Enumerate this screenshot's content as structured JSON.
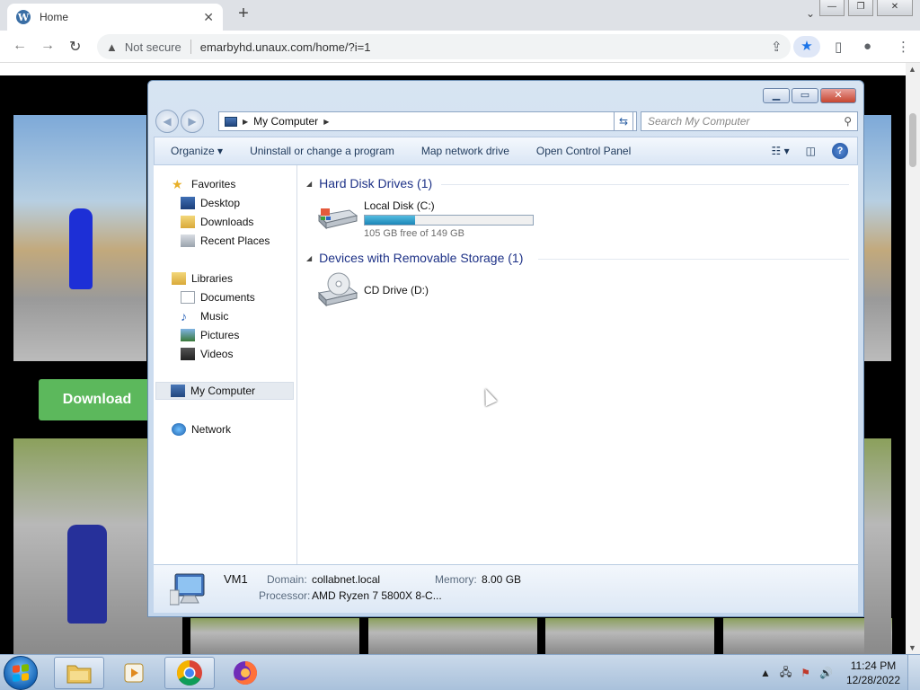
{
  "browser": {
    "tab_title": "Home",
    "tab_close": "✕",
    "new_tab": "+",
    "not_secure": "Not secure",
    "url": "emarbyhd.unaux.com/home/?i=1"
  },
  "page": {
    "download_label": "Download"
  },
  "explorer": {
    "breadcrumb": "My Computer",
    "search_placeholder": "Search My Computer",
    "commands": [
      "Organize ▾",
      "Uninstall or change a program",
      "Map network drive",
      "Open Control Panel"
    ],
    "nav": {
      "favorites": "Favorites",
      "desktop": "Desktop",
      "downloads": "Downloads",
      "recent_places": "Recent Places",
      "libraries": "Libraries",
      "documents": "Documents",
      "music": "Music",
      "pictures": "Pictures",
      "videos": "Videos",
      "my_computer": "My Computer",
      "network": "Network"
    },
    "groups": {
      "hdd": "Hard Disk Drives (1)",
      "removable": "Devices with Removable Storage (1)"
    },
    "drives": {
      "c_name": "Local Disk (C:)",
      "c_free": "105 GB free of 149 GB",
      "c_used_fraction": 0.3,
      "d_name": "CD Drive (D:)"
    },
    "details": {
      "computer_name": "VM1",
      "domain_label": "Domain:",
      "domain_value": "collabnet.local",
      "memory_label": "Memory:",
      "memory_value": "8.00 GB",
      "processor_label": "Processor:",
      "processor_value": "AMD Ryzen 7 5800X 8-C..."
    }
  },
  "taskbar": {
    "time": "11:24 PM",
    "date": "12/28/2022"
  },
  "colors": {
    "download_green": "#5cb85c",
    "explorer_heading": "#1e3287",
    "chrome_blue": "#1a73e8"
  }
}
